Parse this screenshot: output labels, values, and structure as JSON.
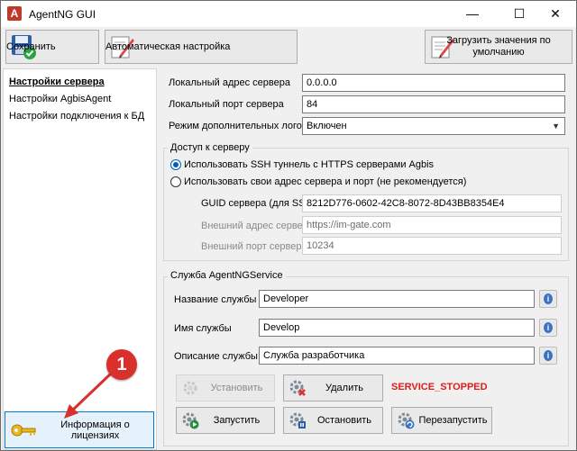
{
  "window": {
    "title": "AgentNG GUI"
  },
  "toolbar": {
    "save_label": "Сохранить",
    "auto_config_label": "Автоматическая настройка",
    "load_defaults_label": "Загрузить значения по умолчанию"
  },
  "sidebar": {
    "items": [
      {
        "label": "Настройки сервера"
      },
      {
        "label": "Настройки AgbisAgent"
      },
      {
        "label": "Настройки подключения к БД"
      }
    ],
    "license_button_label": "Информация о лицензиях"
  },
  "server": {
    "local_address_label": "Локальный адрес сервера",
    "local_address_value": "0.0.0.0",
    "local_port_label": "Локальный порт сервера",
    "local_port_value": "84",
    "log_mode_label": "Режим дополнительных логов",
    "log_mode_value": "Включен"
  },
  "access": {
    "group_title": "Доступ к серверу",
    "option_ssh_label": "Использовать SSH туннель с HTTPS серверами Agbis",
    "option_own_label": "Использовать свои адрес сервера и порт (не рекомендуется)",
    "guid_label": "GUID сервера (для SSH)",
    "guid_value": "8212D776-0602-42C8-8072-8D43BB8354E4",
    "ext_address_label": "Внешний адрес сервера",
    "ext_address_value": "https://im-gate.com",
    "ext_port_label": "Внешний порт сервера",
    "ext_port_value": "10234"
  },
  "service": {
    "group_title": "Служба AgentNGService",
    "name_label": "Название службы",
    "name_value": "Developer",
    "id_label": "Имя службы",
    "id_value": "Develop",
    "desc_label": "Описание службы",
    "desc_value": "Служба разработчика",
    "install_label": "Установить",
    "delete_label": "Удалить",
    "status_text": "SERVICE_STOPPED",
    "start_label": "Запустить",
    "stop_label": "Остановить",
    "restart_label": "Перезапустить"
  },
  "annotation": {
    "number": "1"
  },
  "colors": {
    "status": "#e01b1b",
    "annotation": "#d9302b",
    "accent": "#0078d7"
  }
}
